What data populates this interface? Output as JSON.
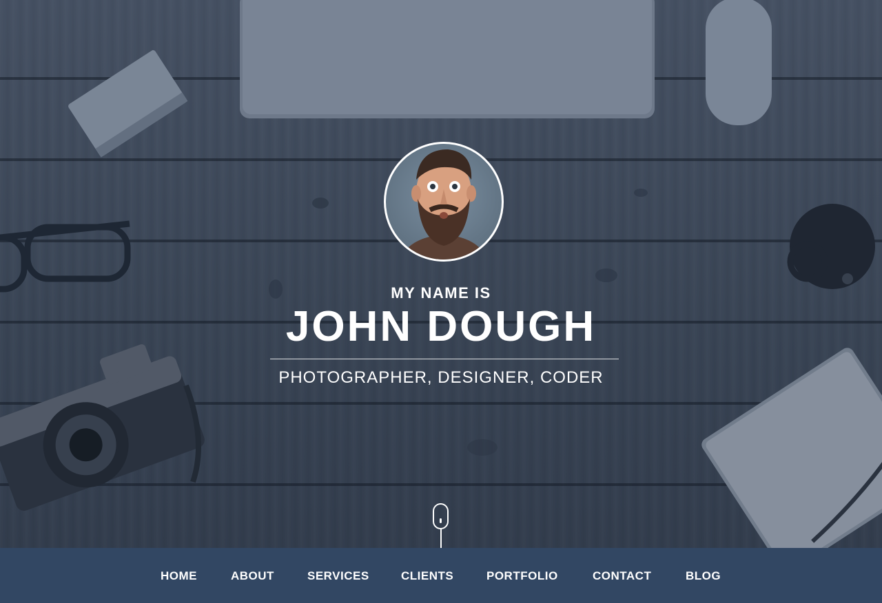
{
  "hero": {
    "intro": "MY NAME IS",
    "name": "JOHN DOUGH",
    "tagline": "PHOTOGRAPHER, DESIGNER, CODER"
  },
  "nav": {
    "items": [
      "HOME",
      "ABOUT",
      "SERVICES",
      "CLIENTS",
      "PORTFOLIO",
      "CONTACT",
      "BLOG"
    ]
  },
  "colors": {
    "navbar_bg": "#324763",
    "text": "#ffffff"
  }
}
